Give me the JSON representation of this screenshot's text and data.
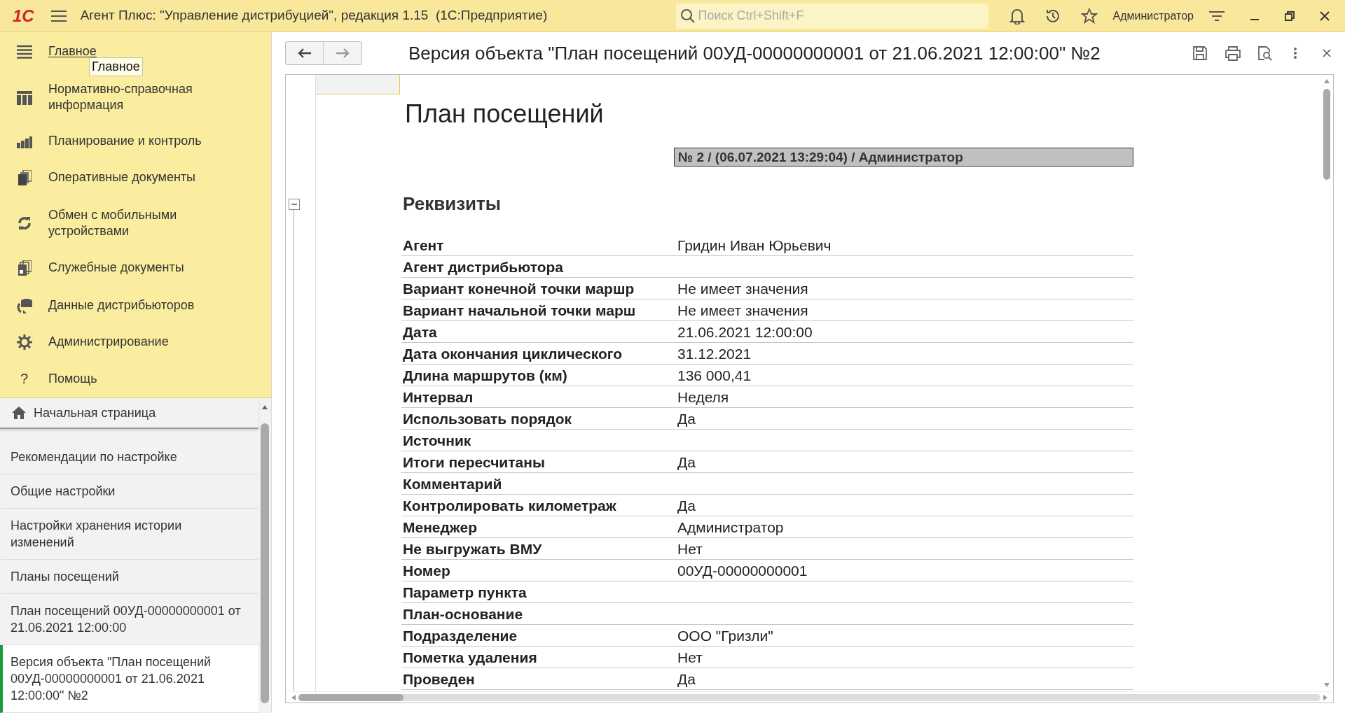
{
  "app_bar": {
    "logo": "1С",
    "title": "Агент Плюс: \"Управление дистрибуцией\", редакция 1.15  (1С:Предприятие)",
    "search": {
      "placeholder": "Поиск Ctrl+Shift+F"
    },
    "user": "Администратор"
  },
  "sections": [
    {
      "label": "Главное",
      "selected": true
    },
    {
      "label": "Нормативно-справочная информация",
      "selected": false
    },
    {
      "label": "Планирование и контроль",
      "selected": false
    },
    {
      "label": "Оперативные документы",
      "selected": false
    },
    {
      "label": "Обмен с мобильными устройствами",
      "selected": false
    },
    {
      "label": "Служебные документы",
      "selected": false
    },
    {
      "label": "Данные дистрибьюторов",
      "selected": false
    },
    {
      "label": "Администрирование",
      "selected": false
    },
    {
      "label": "Помощь",
      "selected": false
    }
  ],
  "tooltip": "Главное",
  "help_glyph": "?",
  "open_windows": {
    "home": "Начальная страница",
    "items": [
      {
        "label": "Рекомендации по настройке",
        "selected": false
      },
      {
        "label": "Общие настройки",
        "selected": false
      },
      {
        "label": "Настройки хранения истории изменений",
        "selected": false
      },
      {
        "label": "Планы посещений",
        "selected": false
      },
      {
        "label": "План посещений 00УД-00000000001 от 21.06.2021 12:00:00",
        "selected": false
      },
      {
        "label": "Версия объекта \"План посещений 00УД-00000000001 от 21.06.2021 12:00:00\" №2",
        "selected": true
      }
    ]
  },
  "form": {
    "title": "Версия объекта \"План посещений 00УД-00000000001 от 21.06.2021 12:00:00\" №2",
    "report": {
      "title": "План посещений",
      "version": "№ 2 / (06.07.2021 13:29:04) / Администратор",
      "section": "Реквизиты",
      "rows": [
        {
          "name": "Агент",
          "value": "Гридин Иван Юрьевич"
        },
        {
          "name": "Агент дистрибьютора"
        },
        {
          "name": "Вариант конечной точки маршр",
          "value": "Не имеет значения"
        },
        {
          "name": "Вариант начальной точки марш",
          "value": "Не имеет значения"
        },
        {
          "name": "Дата",
          "value": "21.06.2021 12:00:00"
        },
        {
          "name": "Дата окончания циклического",
          "value": "31.12.2021"
        },
        {
          "name": "Длина маршрутов (км)",
          "value": "136 000,41"
        },
        {
          "name": "Интервал",
          "value": "Неделя"
        },
        {
          "name": "Использовать порядок",
          "value": "Да"
        },
        {
          "name": "Источник"
        },
        {
          "name": "Итоги пересчитаны",
          "value": "Да"
        },
        {
          "name": "Комментарий"
        },
        {
          "name": "Контролировать километраж",
          "value": "Да"
        },
        {
          "name": "Менеджер",
          "value": "Администратор"
        },
        {
          "name": "Не выгружать ВМУ",
          "value": "Нет"
        },
        {
          "name": "Номер",
          "value": "00УД-00000000001"
        },
        {
          "name": "Параметр пункта"
        },
        {
          "name": "План-основание"
        },
        {
          "name": "Подразделение",
          "value": "ООО \"Гризли\""
        },
        {
          "name": "Пометка удаления",
          "value": "Нет"
        },
        {
          "name": "Проведен",
          "value": "Да"
        }
      ]
    }
  }
}
